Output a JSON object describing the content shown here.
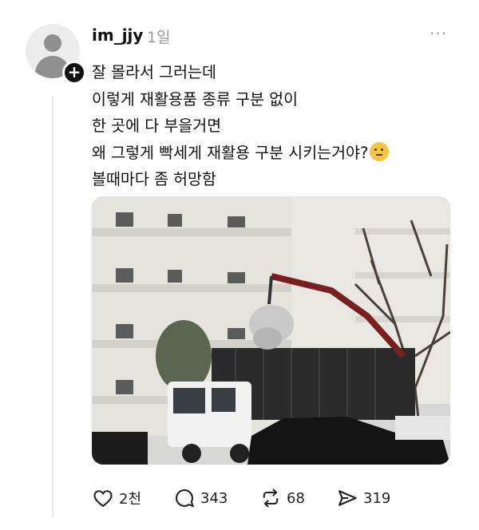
{
  "post": {
    "username": "im_jjy",
    "time": "1일",
    "more_label": "···",
    "lines": [
      "잘 몰라서 그러는데",
      "이렇게 재활용품 종류 구분 없이",
      "한 곳에 다 부을거면",
      "왜 그렇게 빡세게 재활용 구분 시키는거야?",
      "볼때마다 좀 허망함"
    ],
    "emoji": "thinking-face-emoji"
  },
  "follow_badge": "+",
  "actions": {
    "likes": "2천",
    "replies": "343",
    "reposts": "68",
    "shares": "319"
  },
  "colors": {
    "text": "#111111",
    "muted": "#9a9a9a",
    "truck_body": "#2b2b2b",
    "crane": "#7a1f1f"
  }
}
